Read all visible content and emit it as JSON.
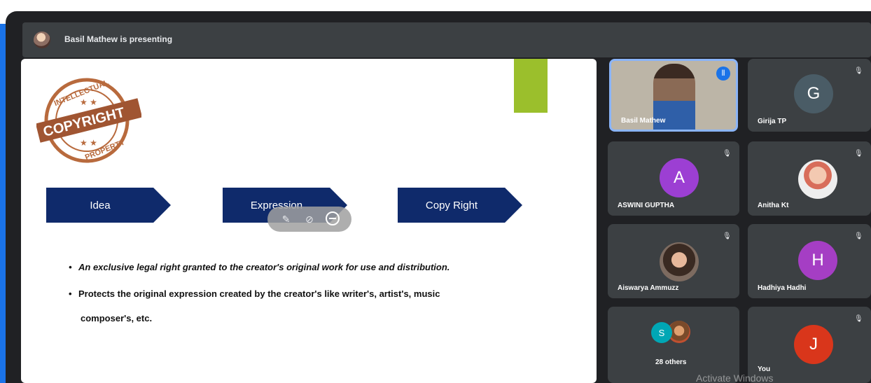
{
  "presenter_bar": {
    "text": "Basil Mathew is presenting"
  },
  "slide": {
    "stamp": {
      "top": "INTELLECTUAL",
      "main": "COPYRIGHT",
      "bottom": "PROPERTY"
    },
    "arrows": [
      "Idea",
      "Expression",
      "Copy Right"
    ],
    "bullets": [
      "An exclusive legal right granted to the creator's original work for use and distribution.",
      "Protects the original  expression created by the creator's like writer's, artist's, music",
      "composer's, etc."
    ],
    "mini_toolbar_icons": [
      "pin-icon",
      "hide-icon",
      "remove-icon"
    ]
  },
  "participants": [
    {
      "name": "Basil Mathew",
      "type": "video",
      "speaking": true
    },
    {
      "name": "Girija TP",
      "initial": "G",
      "color": "#4a5c66",
      "muted": true
    },
    {
      "name": "ASWINI GUPTHA",
      "initial": "A",
      "color": "#9c3fd3",
      "muted": true
    },
    {
      "name": "Anitha Kt",
      "type": "photo",
      "muted": true
    },
    {
      "name": "Aiswarya Ammuzz",
      "type": "photo",
      "muted": true
    },
    {
      "name": "Hadhiya Hadhi",
      "initial": "H",
      "color": "#a53ec4",
      "muted": true
    },
    {
      "name": "28 others",
      "initial": "S",
      "color": "#00a7b5"
    },
    {
      "name": "You",
      "initial": "J",
      "color": "#d9361b",
      "muted": true
    }
  ],
  "watermark": "Activate Windows",
  "colors": {
    "arrow": "#0f2a6b",
    "green_block": "#9bbf2c",
    "tile": "#3c4043",
    "speaking_border": "#8ab4f8"
  }
}
